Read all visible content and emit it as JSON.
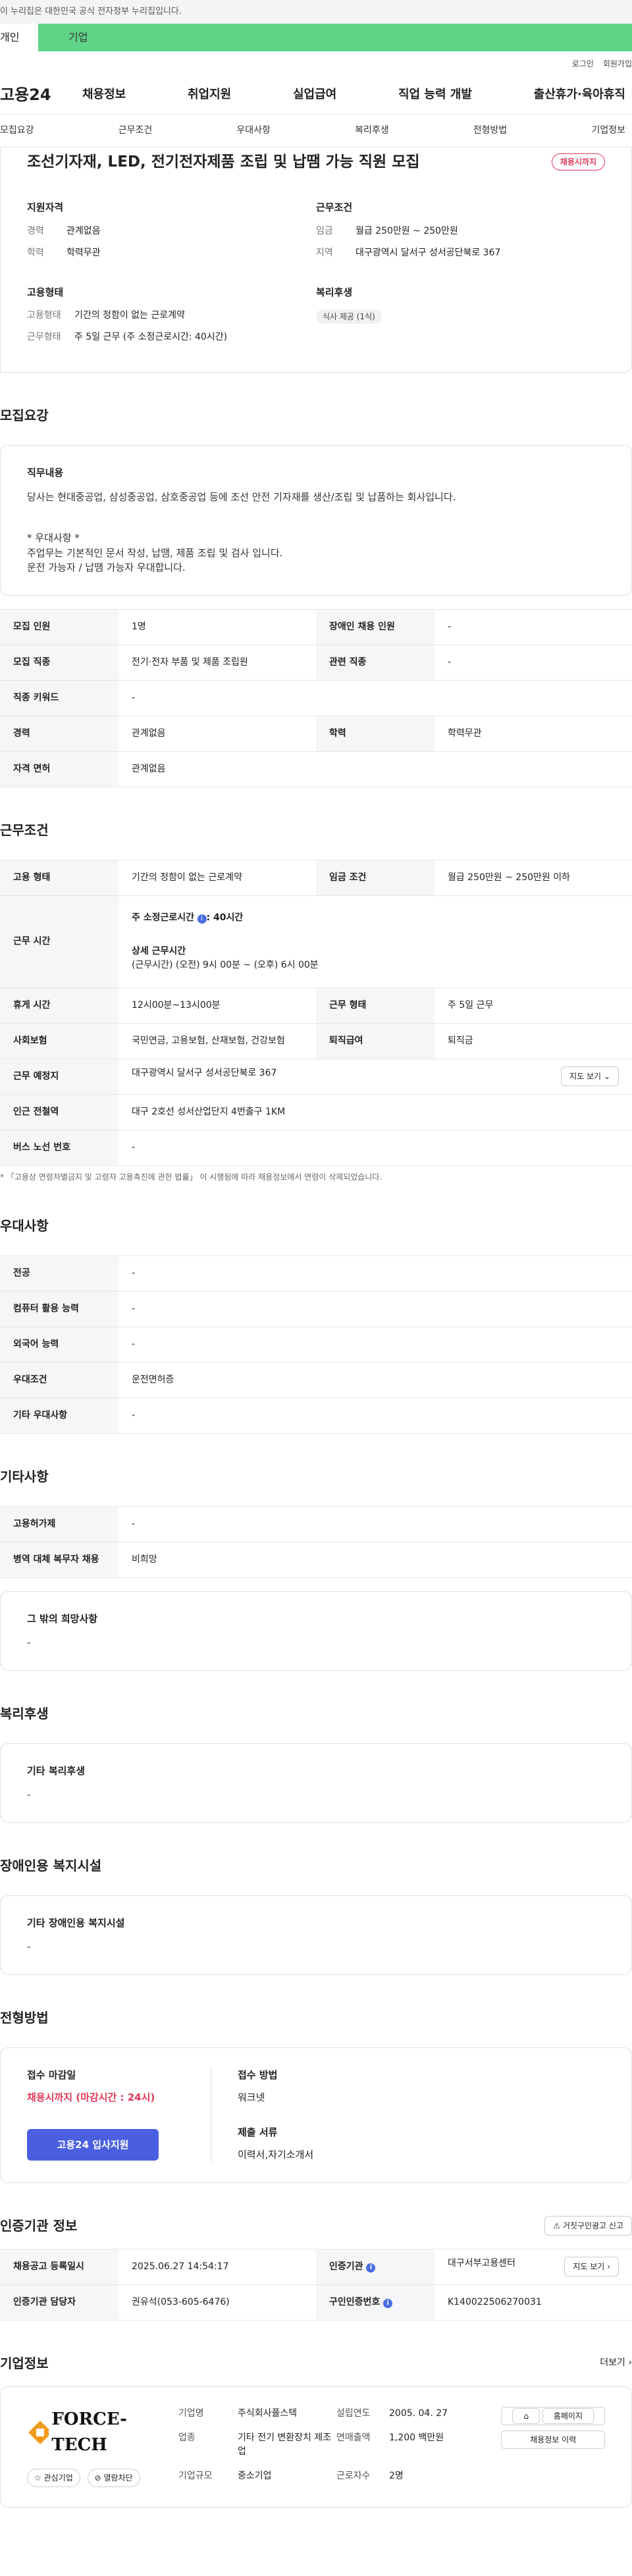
{
  "gov_banner": "이 누리집은 대한민국 공식 전자정부 누리집입니다.",
  "top_tabs": [
    "개인",
    "기업"
  ],
  "util_links": [
    "로그인",
    "회원가입"
  ],
  "logo": "고용24",
  "gnb": [
    "채용정보",
    "취업지원",
    "실업급여",
    "직업 능력 개발",
    "출산휴가·육아휴직"
  ],
  "sub_tabs": [
    "모집요강",
    "근무조건",
    "우대사항",
    "복리후생",
    "전형방법",
    "기업정보"
  ],
  "job": {
    "title": "조선기자재, LED, 전기전자제품 조립 및 납땜 가능 직원 모집",
    "status": "채용시까지",
    "qual_title": "지원자격",
    "qual": [
      {
        "k": "경력",
        "v": "관계없음"
      },
      {
        "k": "학력",
        "v": "학력무관"
      }
    ],
    "cond_title": "근무조건",
    "cond": [
      {
        "k": "임금",
        "v": "월급 250만원 ~ 250만원"
      },
      {
        "k": "지역",
        "v": "대구광역시 달서구 성서공단북로 367"
      }
    ],
    "emp_title": "고용형태",
    "emp": [
      {
        "k": "고용형태",
        "v": "기간의 정함이 없는 근로계약"
      },
      {
        "k": "근무형태",
        "v": "주 5일 근무 (주 소정근로시간: 40시간)"
      }
    ],
    "welfare_title": "복리후생",
    "welfare_chip": "식사 제공 (1식)"
  },
  "recruit": {
    "title": "모집요강",
    "duty_title": "직무내용",
    "duty_text1": "당사는 현대중공업, 삼성중공업, 삼호중공업 등에 조선 안전 기자재를 생산/조립 및 납품하는 회사입니다.",
    "duty_text2": "* 우대사항 *",
    "duty_text3": "주업무는 기본적인 문서 작성, 납땜, 제품 조립 및 검사 입니다.",
    "duty_text4": "운전 가능자 / 납땜 가능자 우대합니다.",
    "rows": [
      [
        "모집 인원",
        "1명",
        "장애인 채용 인원",
        "-"
      ],
      [
        "모집 직종",
        "전기·전자 부품 및 제품 조립원",
        "관련 직종",
        "-"
      ],
      [
        "직종 키워드",
        "-"
      ],
      [
        "경력",
        "관계없음",
        "학력",
        "학력무관"
      ],
      [
        "자격 면허",
        "관계없음"
      ]
    ]
  },
  "work": {
    "title": "근무조건",
    "r1": [
      "고용 형태",
      "기간의 정함이 없는 근로계약",
      "임금 조건",
      "월급 250만원 ~ 250만원 이하"
    ],
    "hours_k": "근무 시간",
    "hours_a": "주 소정근로시간",
    "hours_a2": ": 40시간",
    "hours_b": "상세 근무시간",
    "hours_c": "(근무시간) (오전) 9시 00분 ~ (오후) 6시 00분",
    "r3": [
      "휴게 시간",
      "12시00분~13시00분",
      "근무 형태",
      "주 5일 근무"
    ],
    "r4": [
      "사회보험",
      "국민연금, 고용보험, 산재보험, 건강보험",
      "퇴직급여",
      "퇴직금"
    ],
    "r5": [
      "근무 예정지",
      "대구광역시 달서구 성서공단북로 367"
    ],
    "map_btn": "지도 보기",
    "r6": [
      "인근 전철역",
      "대구 2호선 성서산업단지 4번출구 1KM"
    ],
    "r7": [
      "버스 노선 번호",
      "-"
    ],
    "note": "* 「고용상 연령차별금지 및 고령자 고용촉진에 관한 법률」 이 시행됨에 따라 채용정보에서 연령이 삭제되었습니다."
  },
  "pref": {
    "title": "우대사항",
    "rows": [
      [
        "전공",
        "-"
      ],
      [
        "컴퓨터 활용 능력",
        "-"
      ],
      [
        "외국어 능력",
        "-"
      ],
      [
        "우대조건",
        "운전면허증"
      ],
      [
        "기타 우대사항",
        "-"
      ]
    ]
  },
  "etc": {
    "title": "기타사항",
    "rows": [
      [
        "고용허가제",
        "-"
      ],
      [
        "병역 대체 복무자 채용",
        "비희망"
      ]
    ],
    "box_title": "그 밖의 희망사항",
    "box_val": "-"
  },
  "welfare": {
    "title": "복리후생",
    "box_title": "기타 복리후생",
    "box_val": "-"
  },
  "disabled": {
    "title": "장애인용 복지시설",
    "box_title": "기타 장애인용 복지시설",
    "box_val": "-"
  },
  "apply": {
    "title": "전형방법",
    "deadline_k": "접수 마감일",
    "deadline_v": "채용시까지 (마감시간 : 24시)",
    "btn": "고용24 입사지원",
    "method_k": "접수 방법",
    "method_v": "워크넷",
    "docs_k": "제출 서류",
    "docs_v": "이력서,자기소개서"
  },
  "cert": {
    "title": "인증기관 정보",
    "report_btn": "거짓구인광고 신고",
    "r1": [
      "채용공고 등록일시",
      "2025.06.27 14:54:17",
      "인증기관",
      "대구서부고용센터"
    ],
    "detail_btn": "지도 보기",
    "r2": [
      "인증기관 담당자",
      "권유석(053-605-6476)",
      "구인인증번호",
      "K140022506270031"
    ]
  },
  "corp": {
    "title": "기업정보",
    "more": "더보기",
    "logo_text": "FORCE-TECH",
    "fav_btn": "관심기업",
    "block_btn": "열람차단",
    "info": [
      [
        "기업명",
        "주식회사플스텍",
        "설립연도",
        "2005. 04. 27"
      ],
      [
        "업종",
        "기타 전기 변환장치 제조업",
        "연매출액",
        "1,200 백만원"
      ],
      [
        "기업규모",
        "중소기업",
        "근로자수",
        "2명"
      ]
    ],
    "home_btn": "홈페이지",
    "hist_btn": "채용정보 이력"
  },
  "colors": {
    "accent": "#4a5fe0",
    "green": "#5fd486",
    "red": "#e03a5a"
  }
}
